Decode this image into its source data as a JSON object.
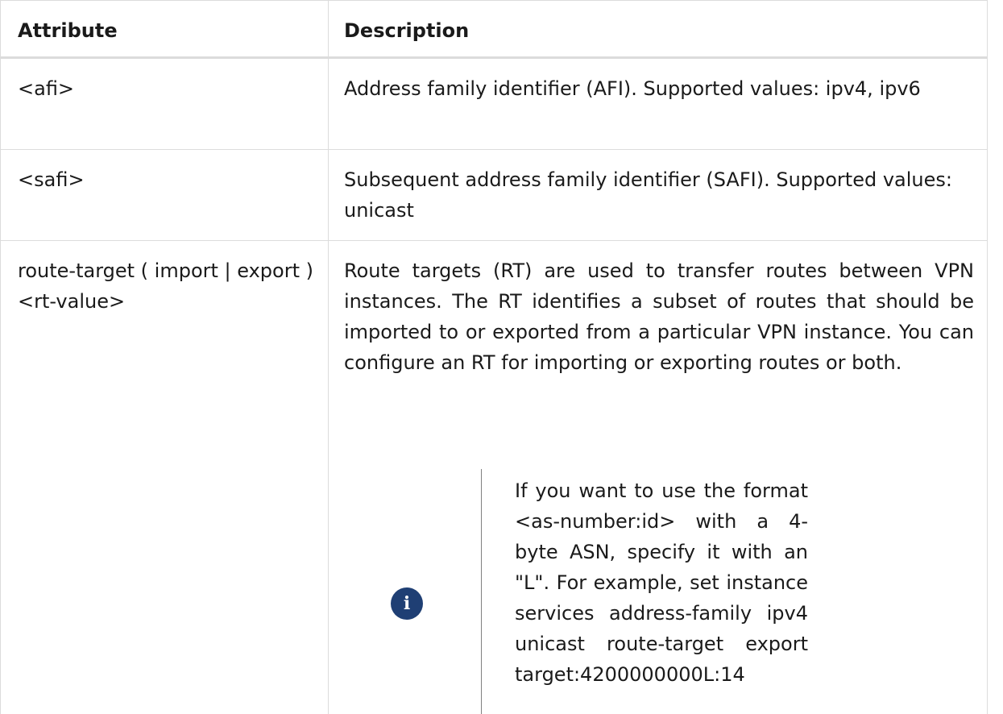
{
  "table": {
    "headers": {
      "attribute": "Attribute",
      "description": "Description"
    },
    "rows": [
      {
        "attribute": "<afi>",
        "description": "Address family identifier (AFI). Supported values: ipv4, ipv6"
      },
      {
        "attribute": "<safi>",
        "description": "Subsequent address family identifier (SAFI). Supported values: unicast"
      },
      {
        "attribute": "route-target ( import | export ) <rt-value>",
        "description": "Route targets (RT) are used to transfer routes between VPN instances. The RT identifies a subset of routes that should be imported to or exported from a particular VPN instance. You can configure an RT for importing or exporting routes or both.",
        "note": {
          "icon": "info-icon",
          "icon_glyph": "i",
          "icon_color": "#1f3f74",
          "text": "If you want to use the format <as-number:id> with a 4-byte ASN, specify it with an \"L\". For example, set instance services address-family ipv4 unicast route-target export target:4200000000L:14"
        }
      }
    ]
  }
}
